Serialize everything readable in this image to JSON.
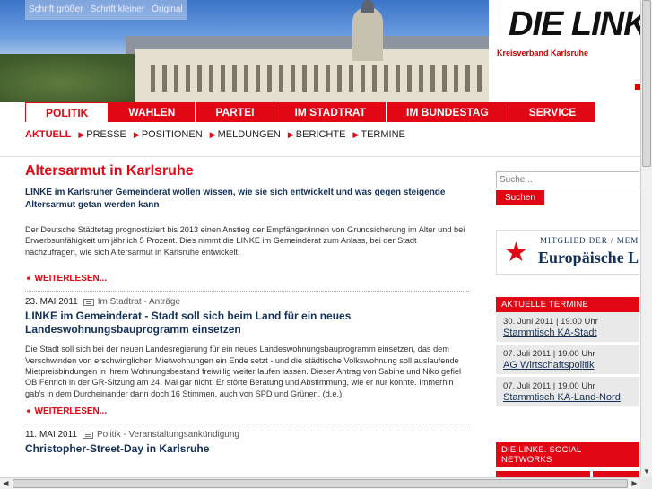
{
  "font_tools": [
    "Schrift größer",
    "Schrift kleiner",
    "Original"
  ],
  "logo": {
    "text": "DIE LINKE",
    "subtitle": "Kreisverband Karlsruhe"
  },
  "main_nav": [
    {
      "label": "POLITIK",
      "active": true
    },
    {
      "label": "WAHLEN"
    },
    {
      "label": "PARTEI"
    },
    {
      "label": "IM STADTRAT"
    },
    {
      "label": "IM BUNDESTAG"
    },
    {
      "label": "SERVICE"
    }
  ],
  "sub_nav": [
    {
      "label": "AKTUELL",
      "active": true
    },
    {
      "label": "PRESSE"
    },
    {
      "label": "POSITIONEN"
    },
    {
      "label": "MELDUNGEN"
    },
    {
      "label": "BERICHTE"
    },
    {
      "label": "TERMINE"
    }
  ],
  "lead_article": {
    "title": "Altersarmut in Karlsruhe",
    "teaser": "LINKE im Karlsruher Gemeinderat wollen wissen, wie sie sich entwickelt und was gegen steigende Altersarmut getan werden kann",
    "body": "Der Deutsche Städtetag prognostiziert bis 2013 einen Anstieg der Empfänger/innen von Grundsicherung im Alter und bei Erwerbsunfähigkeit um jährlich 5 Prozent. Dies nimmt die LINKE im Gemeinderat zum Anlass, bei der Stadt nachzufragen, wie sich Altersarmut in Karlsruhe entwickelt.",
    "more": "WEITERLESEN..."
  },
  "articles": [
    {
      "date": "23. MAI 2011",
      "category": "Im Stadtrat - Anträge",
      "title": "LINKE im Gemeinderat - Stadt soll sich beim Land für ein neues Landeswohnungsbauprogramm einsetzen",
      "body": "Die Stadt soll sich bei der neuen Landesregierung für ein neues Landeswohnungsbauprogramm einsetzen, das dem Verschwinden von erschwinglichen Mietwohnungen ein Ende setzt - und die städtische Volkswohnung soll auslaufende Mietpreisbindungen in ihrem Wohnungsbestand freiwillig weiter laufen lassen. Dieser Antrag von Sabine und Niko gefiel OB Fenrich in der GR-Sitzung am 24. Mai gar nicht: Er störte Beratung und Abstimmung, wie er nur konnte. Immerhin gab's in dem Durcheinander dann doch 16 Stimmen, auch von SPD und Grünen. (d.e.).",
      "more": "WEITERLESEN..."
    },
    {
      "date": "11. MAI 2011",
      "category": "Politik - Veranstaltungsankündigung",
      "title": "Christopher-Street-Day in Karlsruhe"
    }
  ],
  "search": {
    "placeholder": "Suche...",
    "button": "Suchen"
  },
  "eu_banner": {
    "line1": "MITGLIED DER / MEMBER OF",
    "line2": "Europäische Linke"
  },
  "termine": {
    "heading": "AKTUELLE TERMINE",
    "items": [
      {
        "date": "30. Juni 2011 | 19.00 Uhr",
        "title": "Stammtisch KA-Stadt"
      },
      {
        "date": "07. Juli 2011 | 19.00 Uhr",
        "title": "AG Wirtschaftspolitik"
      },
      {
        "date": "07. Juli 2011 | 19.00 Uhr",
        "title": "Stammtisch KA-Land-Nord"
      }
    ]
  },
  "social": {
    "heading": "DIE LINKE. SOCIAL NETWORKS"
  },
  "colors": {
    "brand_red": "#e10714",
    "navy": "#12305a"
  }
}
